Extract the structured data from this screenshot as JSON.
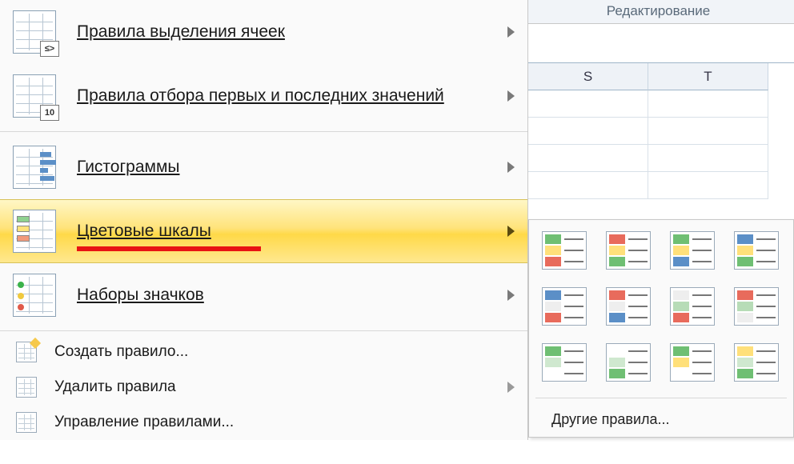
{
  "ribbon": {
    "group_label": "Редактирование"
  },
  "columns": [
    "S",
    "T"
  ],
  "menu": {
    "items": [
      {
        "label": "Правила выделения ячеек",
        "has_submenu": true
      },
      {
        "label": "Правила отбора первых и последних значений",
        "has_submenu": true
      },
      {
        "label": "Гистограммы",
        "has_submenu": true
      },
      {
        "label": "Цветовые шкалы",
        "has_submenu": true,
        "selected": true
      },
      {
        "label": "Наборы значков",
        "has_submenu": true
      }
    ],
    "actions": [
      {
        "label": "Создать правило...",
        "accel": "С"
      },
      {
        "label": "Удалить правила",
        "accel": "У",
        "has_submenu": true
      },
      {
        "label": "Управление правилами...",
        "accel": "п"
      }
    ]
  },
  "gallery": {
    "more_label": "Другие правила...",
    "swatches": [
      {
        "colors": [
          "#6fbf73",
          "#ffe07a",
          "#e86b5c"
        ]
      },
      {
        "colors": [
          "#e86b5c",
          "#ffe07a",
          "#6fbf73"
        ]
      },
      {
        "colors": [
          "#6fbf73",
          "#ffe07a",
          "#5b8fc7"
        ]
      },
      {
        "colors": [
          "#5b8fc7",
          "#ffe07a",
          "#6fbf73"
        ]
      },
      {
        "colors": [
          "#5b8fc7",
          "#eeeeee",
          "#e86b5c"
        ]
      },
      {
        "colors": [
          "#e86b5c",
          "#eeeeee",
          "#5b8fc7"
        ]
      },
      {
        "colors": [
          "#eeeeee",
          "#b7dcb7",
          "#e86b5c"
        ]
      },
      {
        "colors": [
          "#e86b5c",
          "#b7dcb7",
          "#eeeeee"
        ]
      },
      {
        "colors": [
          "#6fbf73",
          "#cfe8cf",
          "#ffffff"
        ]
      },
      {
        "colors": [
          "#ffffff",
          "#cfe8cf",
          "#6fbf73"
        ]
      },
      {
        "colors": [
          "#6fbf73",
          "#ffe07a",
          "#ffffff"
        ]
      },
      {
        "colors": [
          "#ffe07a",
          "#cfe8cf",
          "#6fbf73"
        ]
      }
    ]
  }
}
